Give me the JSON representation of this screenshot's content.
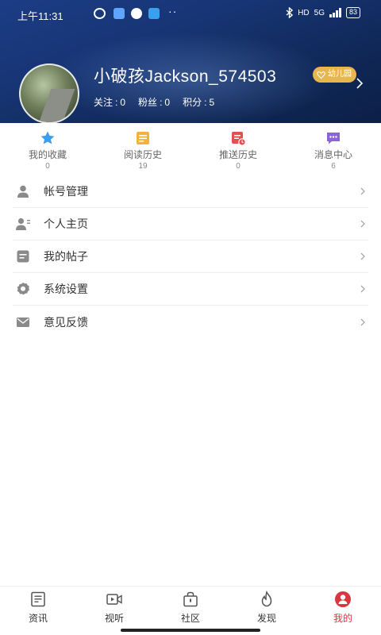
{
  "status_bar": {
    "time": "上午11:31",
    "dots": "··",
    "network": "HD",
    "signal": "5G",
    "battery": "83"
  },
  "profile": {
    "username": "小破孩Jackson_574503",
    "badge": "幼儿园",
    "stats": [
      {
        "label": "关注",
        "value": "0"
      },
      {
        "label": "粉丝",
        "value": "0"
      },
      {
        "label": "积分",
        "value": "5"
      }
    ]
  },
  "quick_actions": [
    {
      "label": "我的收藏",
      "count": "0",
      "icon": "star-icon",
      "color": "#3a9ff0"
    },
    {
      "label": "阅读历史",
      "count": "19",
      "icon": "document-icon",
      "color": "#f3b23a"
    },
    {
      "label": "推送历史",
      "count": "0",
      "icon": "push-history-icon",
      "color": "#e0514f"
    },
    {
      "label": "消息中心",
      "count": "6",
      "icon": "message-icon",
      "color": "#8d63d8"
    }
  ],
  "menu": [
    {
      "label": "帐号管理",
      "icon": "person-icon"
    },
    {
      "label": "个人主页",
      "icon": "profile-page-icon"
    },
    {
      "label": "我的帖子",
      "icon": "posts-icon"
    },
    {
      "label": "系统设置",
      "icon": "gear-icon"
    },
    {
      "label": "意见反馈",
      "icon": "mail-icon"
    }
  ],
  "bottom_nav": [
    {
      "label": "资讯",
      "icon": "news-icon",
      "active": false
    },
    {
      "label": "视听",
      "icon": "video-icon",
      "active": false
    },
    {
      "label": "社区",
      "icon": "community-icon",
      "active": false
    },
    {
      "label": "发现",
      "icon": "discover-flame-icon",
      "active": false
    },
    {
      "label": "我的",
      "icon": "me-icon",
      "active": true
    }
  ],
  "colors": {
    "header_start": "#1c3c86",
    "header_end": "#0c1f48",
    "badge": "#e8b64e",
    "active_tab": "#d9363e",
    "icon_gray": "#8a8a8a"
  }
}
